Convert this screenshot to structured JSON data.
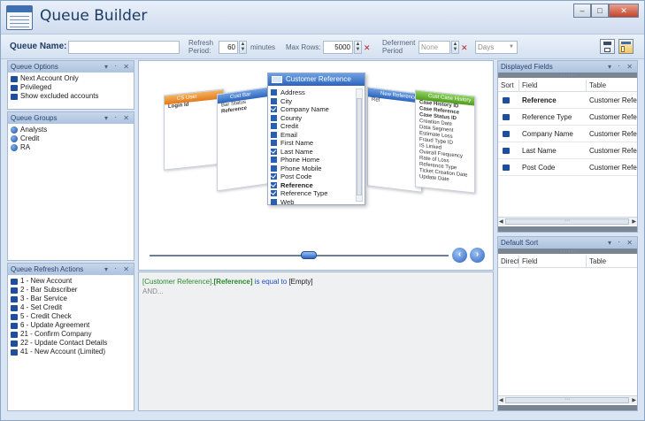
{
  "window": {
    "title": "Queue Builder",
    "controls": [
      "minimize",
      "maximize",
      "close"
    ]
  },
  "toolbar": {
    "queue_name_label": "Queue Name:",
    "queue_name_value": "",
    "refresh_label_1": "Refresh",
    "refresh_label_2": "Period:",
    "refresh_value": "60",
    "refresh_units": "minutes",
    "max_rows_label": "Max Rows:",
    "max_rows_value": "5000",
    "deferment_label_1": "Deferment",
    "deferment_label_2": "Period",
    "deferment_value": "None",
    "deferment_unit": "Days"
  },
  "panels": {
    "queue_options": {
      "title": "Queue Options",
      "items": [
        "Next Account Only",
        "Privileged",
        "Show excluded accounts"
      ]
    },
    "queue_groups": {
      "title": "Queue Groups",
      "items": [
        "Analysts",
        "Credit",
        "RA"
      ]
    },
    "queue_refresh_actions": {
      "title": "Queue Refresh Actions",
      "items": [
        "1 - New Account",
        "2 - Bar Subscriber",
        "3 - Bar Service",
        "4 - Set Credit",
        "5 - Credit Check",
        "6 - Update Agreement",
        "21 - Confirm Company",
        "22 - Update Contact Details",
        "41 - New Account (Limited)"
      ]
    },
    "displayed_fields": {
      "title": "Displayed Fields",
      "columns": [
        "Sort",
        "Field",
        "Table"
      ],
      "rows": [
        {
          "field": "Reference",
          "table": "Customer Reference",
          "bold": true
        },
        {
          "field": "Reference Type",
          "table": "Customer Reference",
          "bold": false
        },
        {
          "field": "Company Name",
          "table": "Customer Reference",
          "bold": false
        },
        {
          "field": "Last Name",
          "table": "Customer Reference",
          "bold": false
        },
        {
          "field": "Post Code",
          "table": "Customer Reference",
          "bold": false
        }
      ]
    },
    "default_sort": {
      "title": "Default Sort",
      "columns": [
        "Direction",
        "Field",
        "Table"
      ]
    }
  },
  "carousel": {
    "main_card": {
      "title": "Customer Reference",
      "fields": [
        {
          "label": "Address",
          "checked": false,
          "bold": false
        },
        {
          "label": "City",
          "checked": false,
          "bold": false
        },
        {
          "label": "Company Name",
          "checked": true,
          "bold": false
        },
        {
          "label": "County",
          "checked": false,
          "bold": false
        },
        {
          "label": "Credit",
          "checked": false,
          "bold": false
        },
        {
          "label": "Email",
          "checked": false,
          "bold": false
        },
        {
          "label": "First Name",
          "checked": false,
          "bold": false
        },
        {
          "label": "Last Name",
          "checked": true,
          "bold": false
        },
        {
          "label": "Phone Home",
          "checked": false,
          "bold": false
        },
        {
          "label": "Phone Mobile",
          "checked": false,
          "bold": false
        },
        {
          "label": "Post Code",
          "checked": true,
          "bold": false
        },
        {
          "label": "Reference",
          "checked": true,
          "bold": true
        },
        {
          "label": "Reference Type",
          "checked": true,
          "bold": false
        },
        {
          "label": "Web",
          "checked": false,
          "bold": false
        }
      ]
    },
    "left_far_card": {
      "title": "CS User",
      "items": [
        "Login Id"
      ]
    },
    "left_card": {
      "title": "Cust Bar",
      "items": [
        "Bar Status",
        "Reference"
      ]
    },
    "right_card": {
      "title": "New Reference St...",
      "items": [
        "Ref"
      ]
    },
    "right_far_card": {
      "title": "Cust Case History",
      "items": [
        "Case History ID",
        "Case Reference",
        "Case Status ID",
        "Creation Date",
        "Data Segment",
        "Estimate Loss",
        "Fraud Type ID",
        "IS Linked",
        "Overall Frequency",
        "Rate of Loss",
        "Reference Type",
        "Ticket Creation Date",
        "Update Date"
      ]
    }
  },
  "criteria": {
    "table": "[Customer Reference]",
    "sep": ".",
    "field": "[Reference]",
    "op": "is equal to",
    "value": "[Empty]",
    "and_text": "AND..."
  }
}
